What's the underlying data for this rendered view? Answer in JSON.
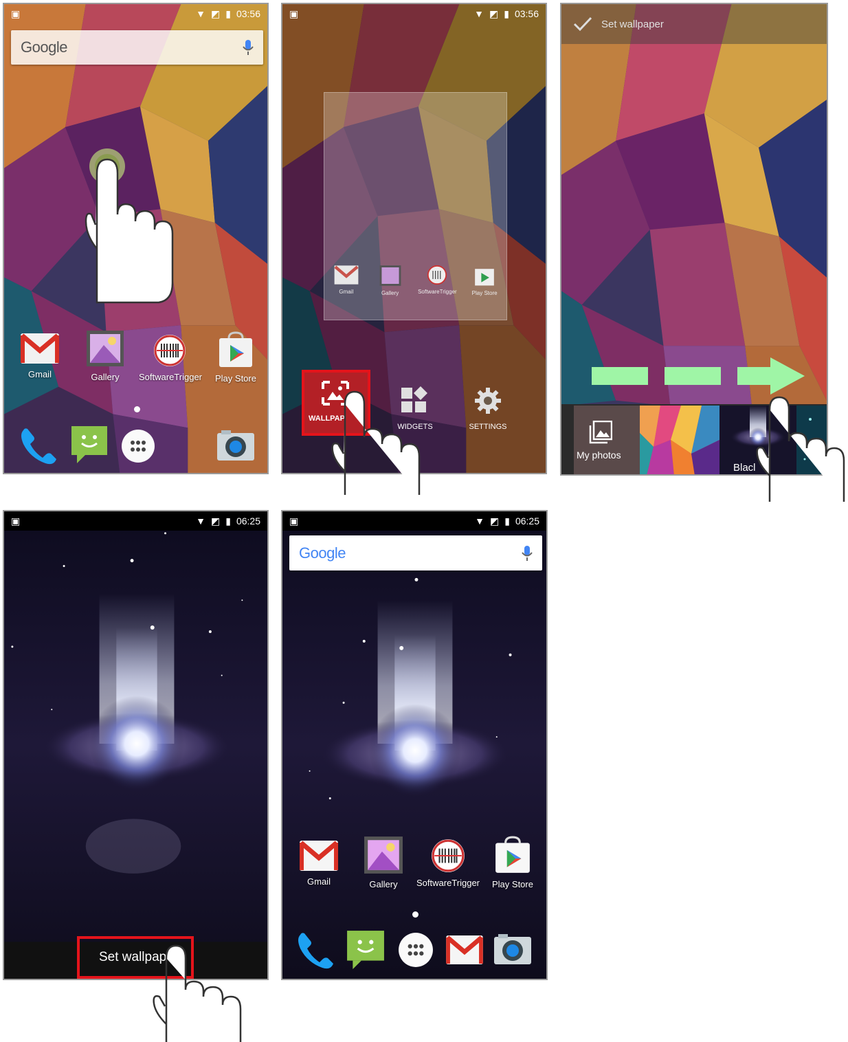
{
  "panels": [
    {
      "id": "step1",
      "status_time": "03:56",
      "search_logo": "Google",
      "apps": [
        "Gmail",
        "Gallery",
        "SoftwareTrigger",
        "Play Store"
      ]
    },
    {
      "id": "step2",
      "status_time": "03:56",
      "preview_apps": [
        "Gmail",
        "Gallery",
        "SoftwareTrigger",
        "Play Store"
      ],
      "menu": [
        "WALLPAP",
        "WIDGETS",
        "SETTINGS"
      ]
    },
    {
      "id": "step3",
      "header": "Set wallpaper",
      "thumbs": [
        "My photos",
        "Blacl"
      ]
    },
    {
      "id": "step4",
      "status_time": "06:25",
      "action": "Set wallpap"
    },
    {
      "id": "step5",
      "status_time": "06:25",
      "search_logo": "Google",
      "apps": [
        "Gmail",
        "Gallery",
        "SoftwareTrigger",
        "Play Store"
      ]
    }
  ],
  "colors": {
    "highlight": "#e4141b",
    "arrow": "#9ff5a6",
    "google_blue": "#4285f4",
    "google_red": "#ea4335",
    "google_yellow": "#fbbc05",
    "google_green": "#34a853"
  }
}
